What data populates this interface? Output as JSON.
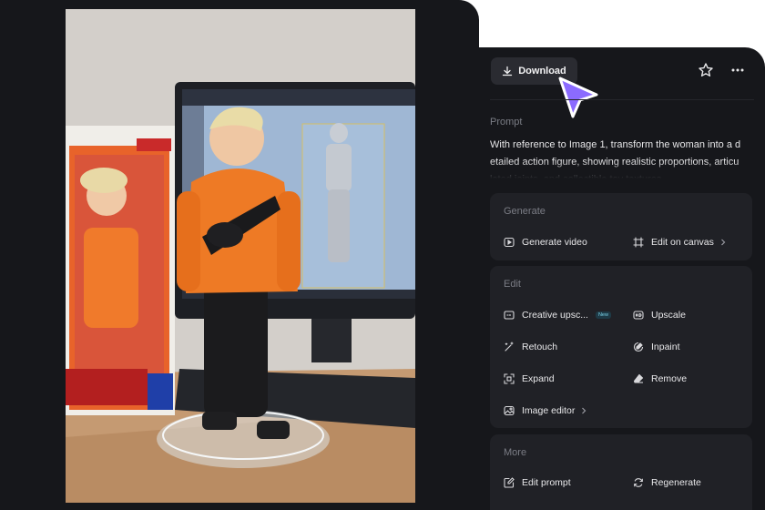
{
  "toolbar": {
    "download_label": "Download",
    "icons": [
      "download-icon",
      "star-icon",
      "more-icon",
      "cursor-arrow-icon"
    ],
    "accent_color": "#8b6bff"
  },
  "prompt": {
    "label": "Prompt",
    "lines": [
      "With reference to Image 1, transform the woman into a d",
      "etailed action figure, showing realistic proportions, articu",
      "lated joints, and collectible toy textures."
    ]
  },
  "generate": {
    "title": "Generate",
    "items": [
      {
        "label": "Generate video",
        "icon": "play-icon"
      },
      {
        "label": "Edit on canvas",
        "icon": "canvas-icon",
        "has_chevron": true
      }
    ]
  },
  "edit": {
    "title": "Edit",
    "items": [
      {
        "label": "Creative upsc...",
        "icon": "creative-upscale-icon",
        "badge": "New"
      },
      {
        "label": "Upscale",
        "icon": "hd-icon"
      },
      {
        "label": "Retouch",
        "icon": "wand-icon"
      },
      {
        "label": "Inpaint",
        "icon": "inpaint-icon"
      },
      {
        "label": "Expand",
        "icon": "expand-icon"
      },
      {
        "label": "Remove",
        "icon": "eraser-icon"
      },
      {
        "label": "Image editor",
        "icon": "image-editor-icon",
        "has_chevron": true
      }
    ]
  },
  "more": {
    "title": "More",
    "items": [
      {
        "label": "Edit prompt",
        "icon": "edit-prompt-icon"
      },
      {
        "label": "Regenerate",
        "icon": "regenerate-icon"
      }
    ]
  }
}
